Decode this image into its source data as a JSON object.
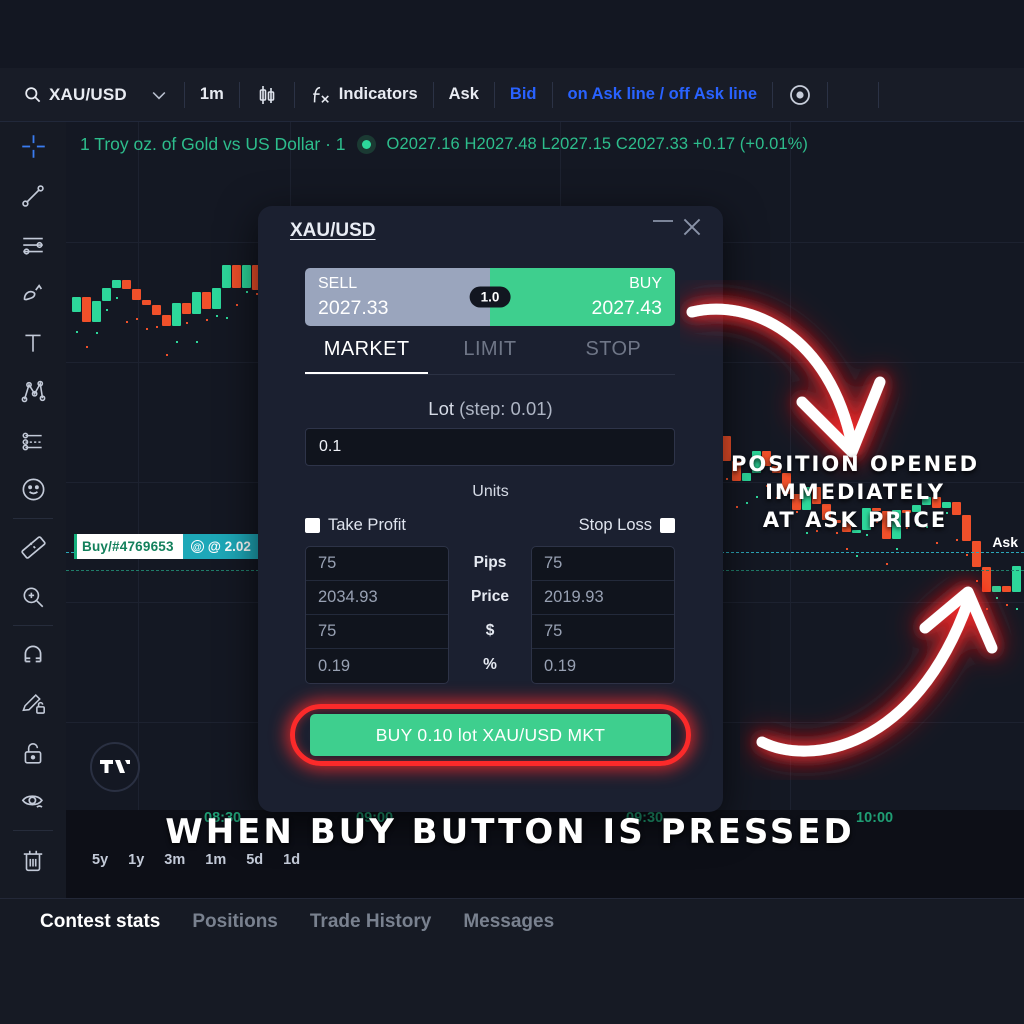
{
  "toolbar": {
    "search_icon": "search-icon",
    "symbol": "XAU/USD",
    "chevron": "chevron-down-icon",
    "timeframe": "1m",
    "chart_type_icon": "candles-icon",
    "fx_icon": "fx-icon",
    "indicators": "Indicators",
    "ask": "Ask",
    "bid": "Bid",
    "ask_line_toggle": "on Ask line / off Ask line",
    "eye_icon": "eye-icon"
  },
  "chart": {
    "legend_title": "1 Troy oz. of Gold vs US Dollar · 1",
    "ohlc": "O2027.16 H2027.48 L2027.15 C2027.33 +0.17 (+0.01%)",
    "open": "2027.16",
    "high": "2027.48",
    "low": "2027.15",
    "close": "2027.33",
    "change": "+0.17",
    "change_pct": "(+0.01%)",
    "ask_label": "Ask",
    "position_label": "Buy/#4769653",
    "position_price": "@ 2.02",
    "time_labels": [
      "08:30",
      "09:00",
      "09:30",
      "10:00"
    ],
    "timeframes": [
      "5y",
      "1y",
      "3m",
      "1m",
      "5d",
      "1d"
    ],
    "logo": "tradingview-logo"
  },
  "left_rail": [
    {
      "name": "crosshair-icon"
    },
    {
      "name": "trend-line-icon"
    },
    {
      "name": "horizontal-lines-icon"
    },
    {
      "name": "brush-icon"
    },
    {
      "name": "text-tool-icon"
    },
    {
      "name": "patterns-icon"
    },
    {
      "name": "forecast-icon"
    },
    {
      "name": "emoji-icon"
    },
    {
      "name": "measure-icon"
    },
    {
      "name": "zoom-in-icon"
    },
    {
      "name": "magnet-icon"
    },
    {
      "name": "pencil-lock-icon"
    },
    {
      "name": "lock-icon"
    },
    {
      "name": "eye-hide-icon"
    },
    {
      "name": "trash-icon"
    }
  ],
  "dialog": {
    "title": "XAU/USD",
    "minimize_icon": "minimize-icon",
    "close_icon": "close-icon",
    "sell_label": "SELL",
    "sell_price": "2027.33",
    "buy_label": "BUY",
    "buy_price": "2027.43",
    "spread_pill": "1.0",
    "tabs": [
      {
        "label": "MARKET",
        "active": true
      },
      {
        "label": "LIMIT",
        "active": false
      },
      {
        "label": "STOP",
        "active": false
      }
    ],
    "lot_label": "Lot",
    "lot_step": "(step: 0.01)",
    "lot_value": "0.1",
    "units_label": "Units",
    "take_profit_label": "Take Profit",
    "stop_loss_label": "Stop Loss",
    "rows": [
      {
        "unit": "Pips",
        "tp": "75",
        "sl": "75"
      },
      {
        "unit": "Price",
        "tp": "2034.93",
        "sl": "2019.93"
      },
      {
        "unit": "$",
        "tp": "75",
        "sl": "75"
      },
      {
        "unit": "%",
        "tp": "0.19",
        "sl": "0.19"
      }
    ],
    "submit_label": "BUY  0.10 lot XAU/USD MKT"
  },
  "bottom_tabs": [
    {
      "label": "Contest stats",
      "active": true
    },
    {
      "label": "Positions",
      "active": false
    },
    {
      "label": "Trade History",
      "active": false
    },
    {
      "label": "Messages",
      "active": false
    }
  ],
  "annotations": {
    "right_line1": "POSITION  OPENED",
    "right_line2": "IMMEDIATELY",
    "right_line3": "AT ASK PRICE",
    "bottom": "WHEN  BUY BUTTON IS PRESSED",
    "arrow_color": "#fb2a2a"
  }
}
